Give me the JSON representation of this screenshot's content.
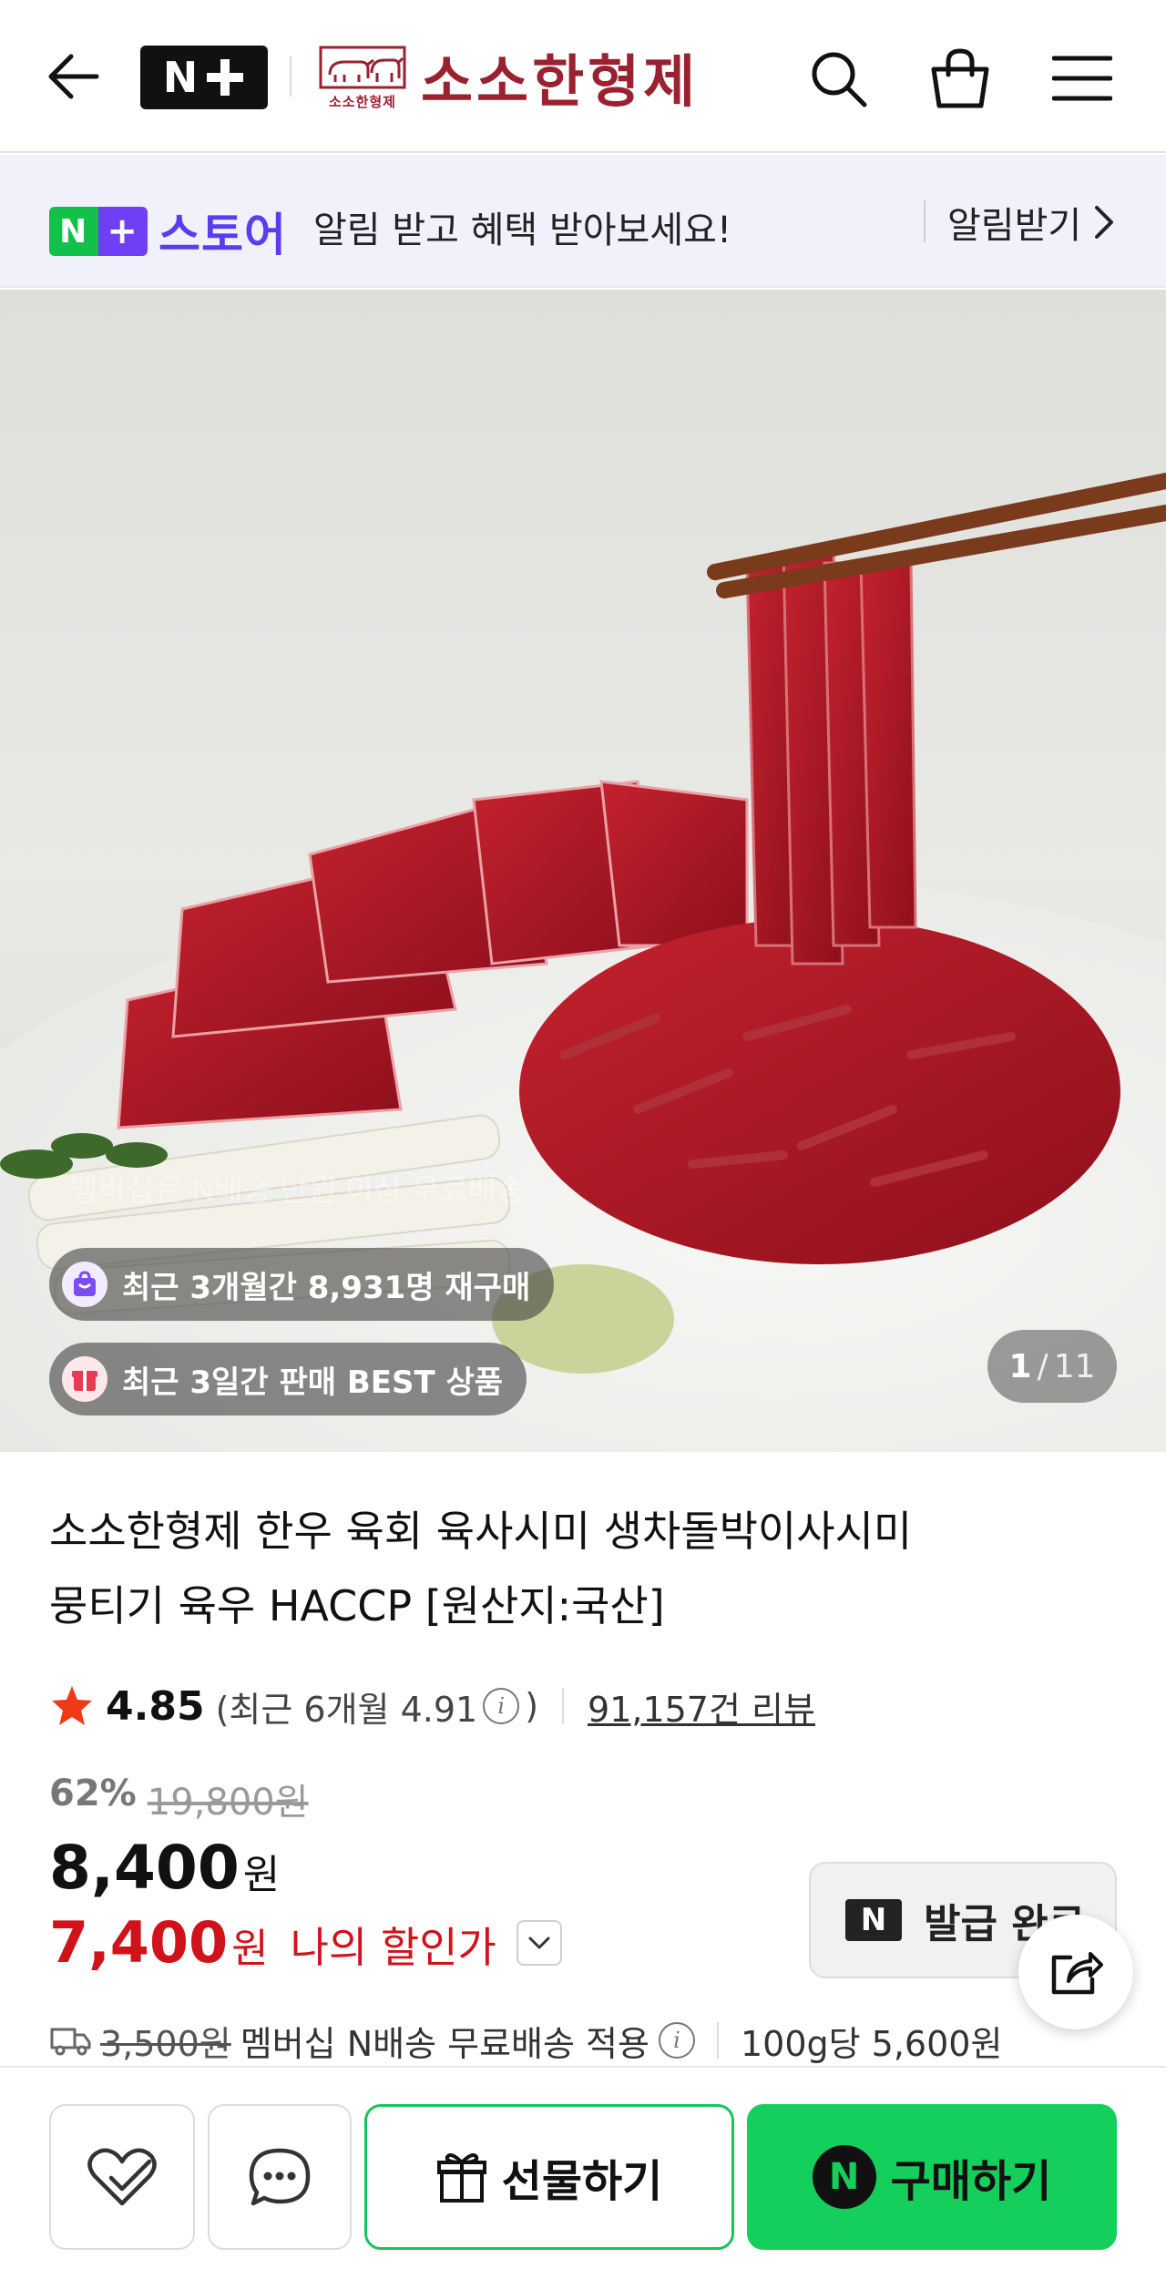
{
  "header": {
    "brand_logo": "N+",
    "brand_name": "소소한형제",
    "brand_emblem_text": "소소한형제",
    "icons": [
      "back-arrow-icon",
      "search-icon",
      "shopping-bag-icon",
      "hamburger-menu-icon"
    ]
  },
  "notice": {
    "store_logo": "N+",
    "store_label": "스토어",
    "message": "알림 받고 혜택 받아보세요!",
    "button_label": "알림받기"
  },
  "hero": {
    "watermark": "멤버십은 N배송 만원 이상 무료배송",
    "badge_repurchase": "최근 3개월간 8,931명 재구매",
    "badge_best": "최근 3일간 판매 BEST 상품",
    "page_current": "1",
    "page_separator": "/",
    "page_total": "11"
  },
  "product": {
    "title_line1": "소소한형제 한우 육회 육사시미 생차돌박이사시미",
    "title_line2": "뭉티기 육우 HACCP [원산지:국산]",
    "rating": "4.85",
    "recent_rating_prefix": "(최근 6개월 4.91",
    "recent_rating_suffix": ")",
    "review_count": "91,157건 리뷰",
    "discount_rate": "62%",
    "original_price": "19,800원",
    "price": "8,400",
    "currency": "원",
    "my_price": "7,400",
    "my_price_label": "나의 할인가",
    "coupon_label": "발급 완료",
    "coupon_badge": "N",
    "shipping_fee": "3,500원",
    "shipping_text": "멤버십 N배송 무료배송 적용",
    "unit_price": "100g당 5,600원"
  },
  "bottom_bar": {
    "gift_label": "선물하기",
    "buy_label": "구매하기",
    "buy_badge": "N"
  },
  "colors": {
    "brand_red": "#9a2230",
    "sale_red": "#d0121b",
    "naver_green": "#14cf5c",
    "store_purple": "#5b3cf0"
  }
}
